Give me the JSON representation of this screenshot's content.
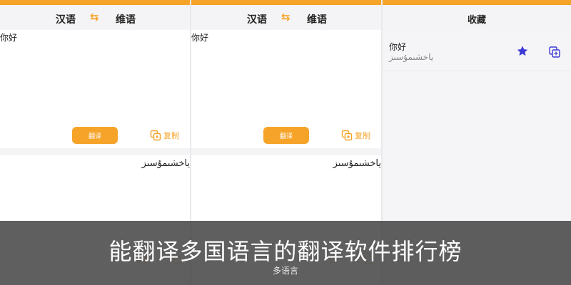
{
  "translator": {
    "source_lang": "汉语",
    "target_lang": "维语",
    "swap_icon": "swap-arrows-icon",
    "input_text": "你好",
    "translate_label": "翻译",
    "copy_label": "复制",
    "result_text": "ياخشىمۇسىز"
  },
  "favorites": {
    "title": "收藏",
    "items": [
      {
        "source": "你好",
        "target": "ياخشىمۇسىز"
      }
    ]
  },
  "overlay": {
    "title": "能翻译多国语言的翻译软件排行榜",
    "subtitle": "多语言"
  },
  "colors": {
    "accent": "#f6a429",
    "star": "#3d3bd6"
  }
}
